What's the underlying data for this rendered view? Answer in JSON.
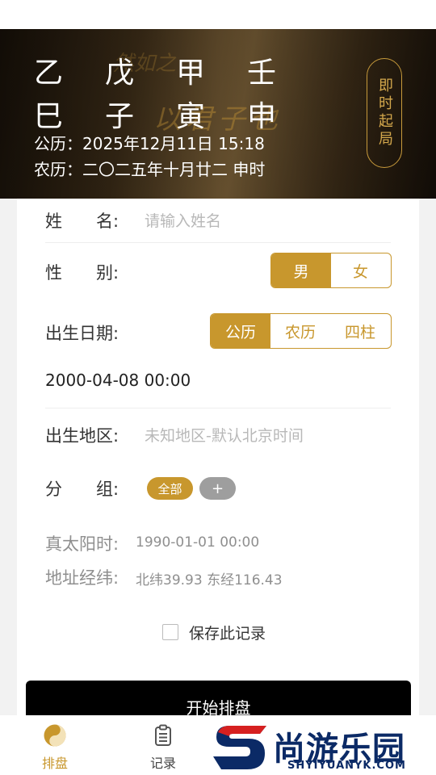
{
  "header": {
    "pillars_top": [
      "乙",
      "戊",
      "甲",
      "壬"
    ],
    "pillars_bottom": [
      "巳",
      "子",
      "寅",
      "申"
    ],
    "solar_date": "公历：2025年12月11日 15:18",
    "lunar_date": "农历：二〇二五年十月廿二 申时",
    "now_button": "即时起局"
  },
  "form": {
    "name_label": "姓　　名:",
    "name_placeholder": "请输入姓名",
    "gender_label": "性　　别:",
    "gender_options": [
      "男",
      "女"
    ],
    "gender_selected": "男",
    "birth_date_label": "出生日期:",
    "calendar_options": [
      "公历",
      "农历",
      "四柱"
    ],
    "calendar_selected": "公历",
    "birth_datetime": "2000-04-08 00:00",
    "birth_place_label": "出生地区:",
    "birth_place_placeholder": "未知地区-默认北京时间",
    "group_label": "分　　组:",
    "group_all": "全部",
    "group_add": "+",
    "true_solar_label": "真太阳时:",
    "true_solar_value": "1990-01-01 00:00",
    "coords_label": "地址经纬:",
    "coords_value": "北纬39.93 东经116.43",
    "save_record_label": "保存此记录",
    "save_record_checked": false,
    "start_button": "开始排盘"
  },
  "tabbar": {
    "tabs": [
      {
        "label": "排盘",
        "icon": "yin-yang-icon",
        "active": true
      },
      {
        "label": "记录",
        "icon": "clipboard-icon",
        "active": false
      }
    ]
  },
  "watermark": {
    "text": "尚游乐园",
    "subtext": "SHYIYUANYK.COM"
  },
  "colors": {
    "accent": "#c8972d",
    "header_text": "#ffffff",
    "placeholder": "#b8b8b8",
    "grey_chip": "#9e9e9e"
  }
}
